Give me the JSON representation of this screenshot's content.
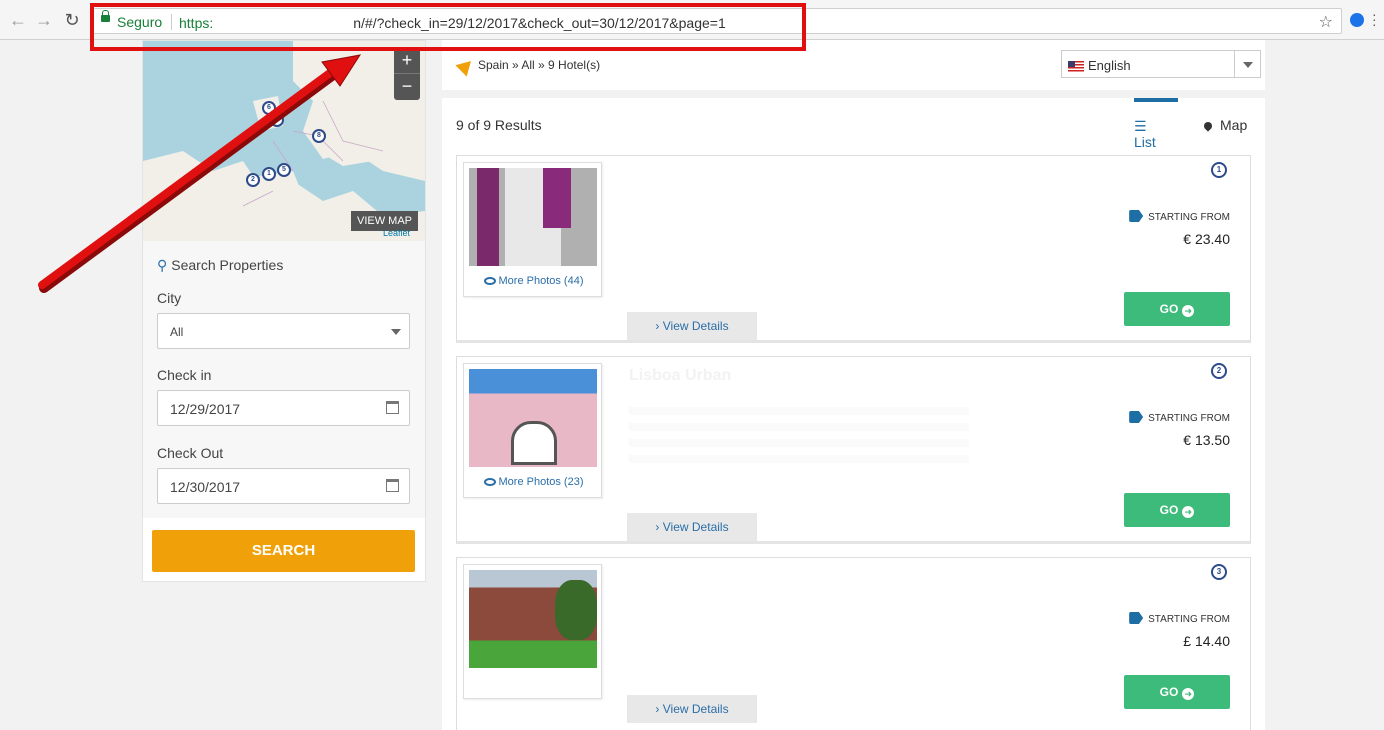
{
  "browser": {
    "secure_label": "Seguro",
    "url_prefix": "https:",
    "url_suffix": "n/#/?check_in=29/12/2017&check_out=30/12/2017&page=1"
  },
  "map": {
    "zoom_in": "+",
    "zoom_out": "−",
    "view_map": "VIEW MAP",
    "attribution": "Leaflet",
    "pins": [
      "6",
      "7",
      "8",
      "1",
      "5",
      "2"
    ]
  },
  "search": {
    "title": "Search Properties",
    "city_label": "City",
    "city_value": "All",
    "checkin_label": "Check in",
    "checkin_value": "12/29/2017",
    "checkout_label": "Check Out",
    "checkout_value": "12/30/2017",
    "button": "SEARCH"
  },
  "breadcrumb": "Spain » All » 9 Hotel(s)",
  "language": "English",
  "results": {
    "count": "9 of 9 Results",
    "tab_list": "List",
    "tab_map": "Map",
    "starting_from": "STARTING FROM",
    "go_label": "GO",
    "view_details": "View Details",
    "hotels": [
      {
        "num": "1",
        "name": "",
        "more_photos": "More Photos (44)",
        "price": "€ 23.40"
      },
      {
        "num": "2",
        "name": "Lisboa Urban",
        "more_photos": "More Photos (23)",
        "price": "€ 13.50"
      },
      {
        "num": "3",
        "name": "",
        "more_photos": "",
        "price": "£ 14.40"
      }
    ]
  },
  "colors": {
    "accent": "#1c6ea4",
    "go": "#3dbb7a",
    "search": "#f0a10a",
    "annotation": "#e01010"
  }
}
